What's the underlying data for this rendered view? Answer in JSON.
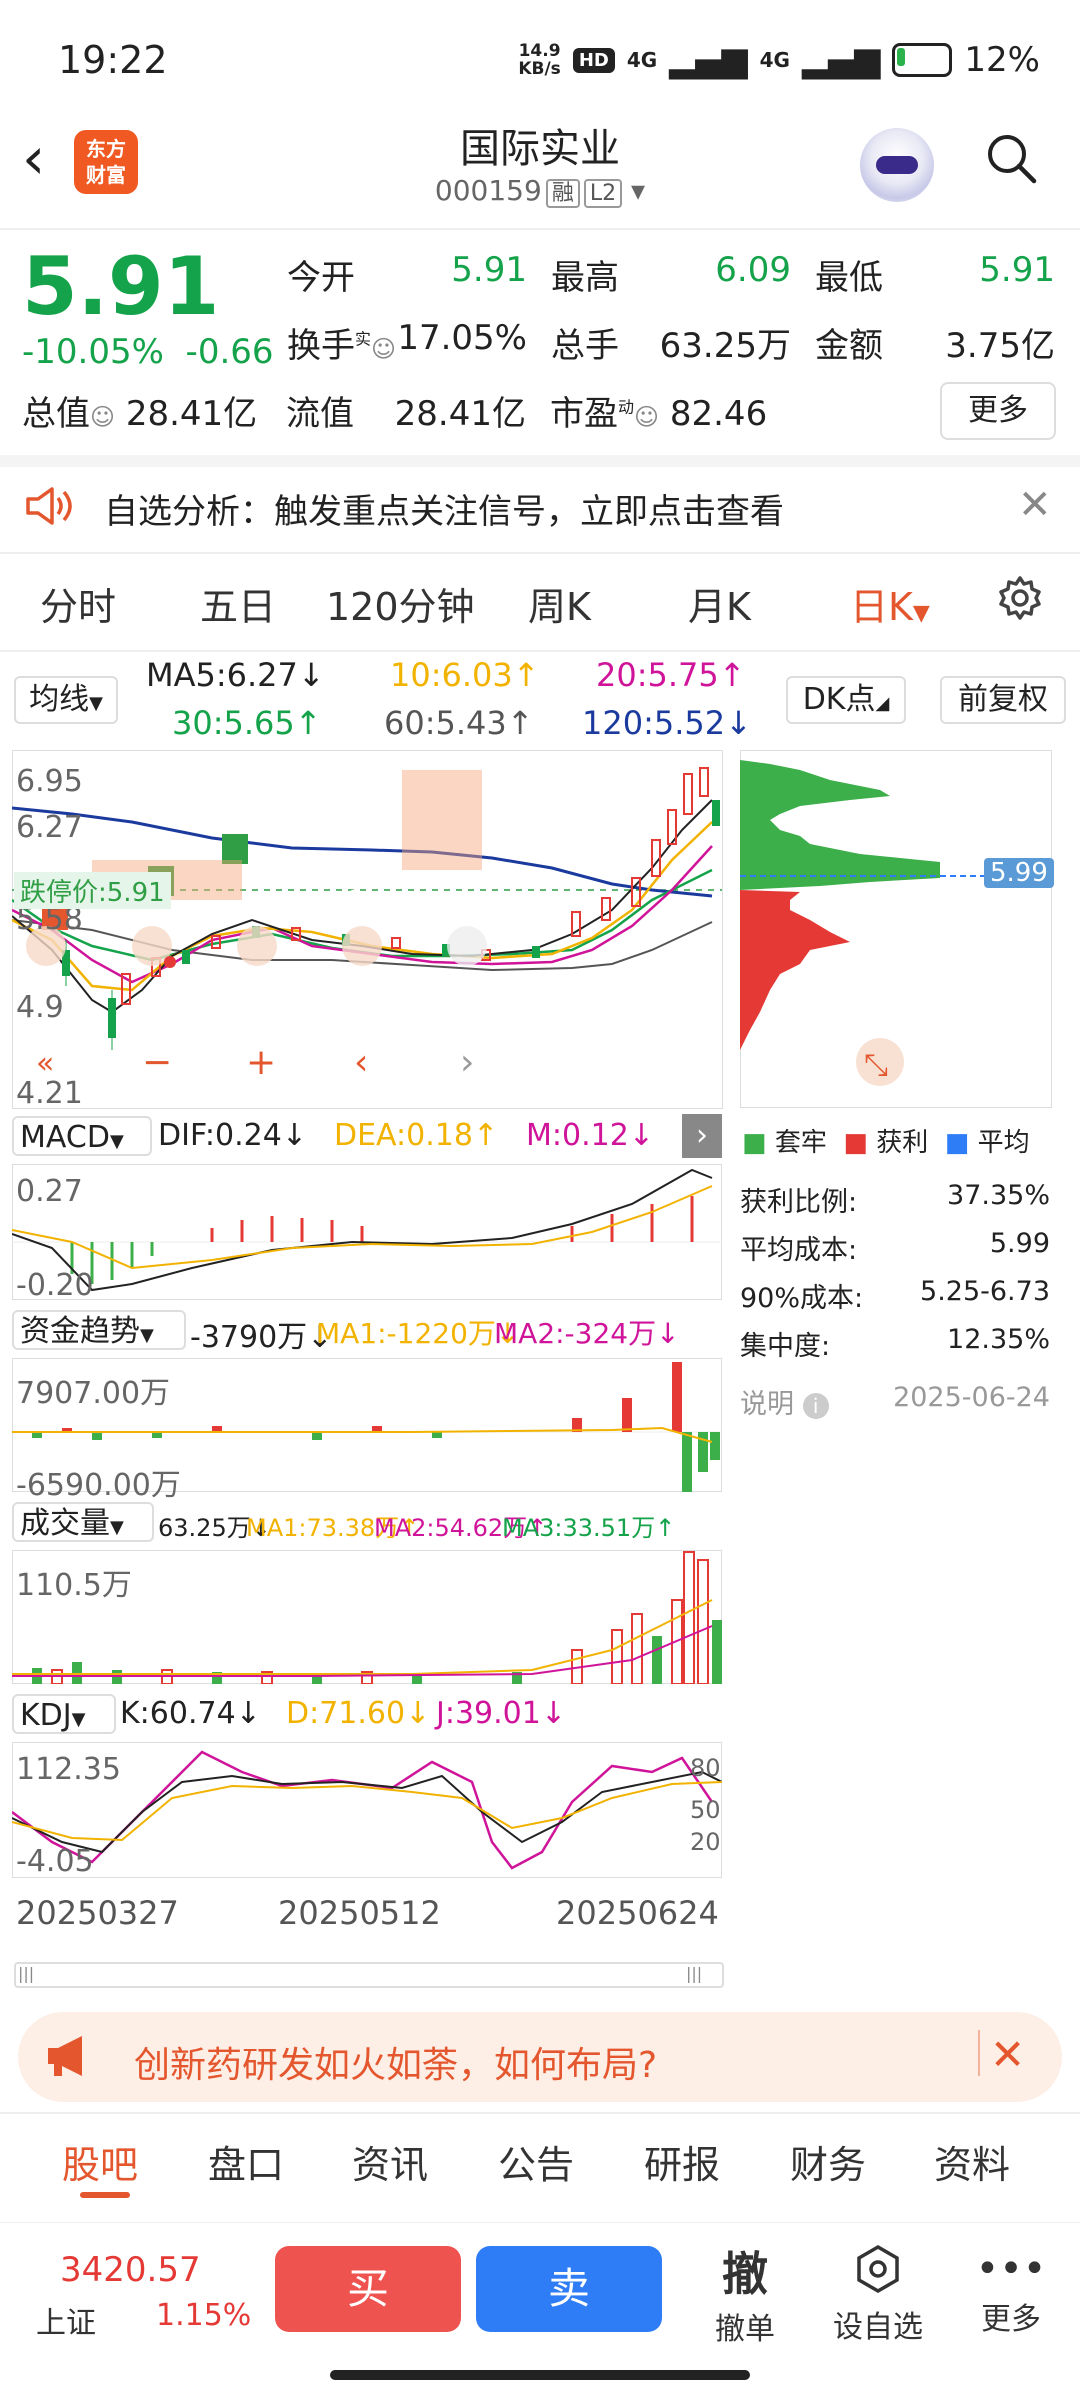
{
  "status_bar": {
    "time": "19:22",
    "net_speed_top": "14.9",
    "net_speed_unit": "KB/s",
    "hd": "HD",
    "sig1": "4G",
    "sig2": "4G",
    "battery": "12%"
  },
  "header": {
    "logo_line1": "东方",
    "logo_line2": "财富",
    "title": "国际实业",
    "code": "000159",
    "tag1": "融",
    "tag2": "L2"
  },
  "quote": {
    "price": "5.91",
    "change_pct": "-10.05%",
    "change": "-0.66",
    "open_label": "今开",
    "open": "5.91",
    "high_label": "最高",
    "high": "6.09",
    "low_label": "最低",
    "low": "5.91",
    "turnover_label": "换手",
    "turnover_sup": "实",
    "turnover": "17.05%",
    "volume_label": "总手",
    "volume": "63.25万",
    "amount_label": "金额",
    "amount": "3.75亿",
    "total_value_label": "总值",
    "total_value": "28.41亿",
    "float_value_label": "流值",
    "float_value": "28.41亿",
    "pe_label": "市盈",
    "pe_sup": "动",
    "pe": "82.46",
    "more": "更多"
  },
  "notice": {
    "text": "自选分析：触发重点关注信号，立即点击查看"
  },
  "tabs": [
    "分时",
    "五日",
    "120分钟",
    "周K",
    "月K",
    "日K"
  ],
  "ma_row": {
    "selector": "均线",
    "ma5": "MA5:6.27↓",
    "ma10": "10:6.03↑",
    "ma20": "20:5.75↑",
    "ma30": "30:5.65↑",
    "ma60": "60:5.43↑",
    "ma120": "120:5.52↓",
    "dk": "DK点",
    "fq": "前复权"
  },
  "main_chart": {
    "y_top": "6.95",
    "y_2": "6.27",
    "y_3": "5.58",
    "y_4": "4.9",
    "y_bottom": "4.21",
    "limit_label": "跌停价:5.91",
    "marker_9": "9",
    "chip_price": "5.99"
  },
  "chip_legend": {
    "a": "套牢",
    "b": "获利",
    "c": "平均"
  },
  "chip_info": [
    {
      "label": "获利比例:",
      "value": "37.35%"
    },
    {
      "label": "平均成本:",
      "value": "5.99"
    },
    {
      "label": "90%成本:",
      "value": "5.25-6.73"
    },
    {
      "label": "集中度:",
      "value": "12.35%"
    },
    {
      "label": "说明",
      "value": "2025-06-24"
    }
  ],
  "macd": {
    "selector": "MACD",
    "dif": "DIF:0.24↓",
    "dea": "DEA:0.18↑",
    "m": "M:0.12↓",
    "y_top": "0.27",
    "y_bottom": "-0.20"
  },
  "fund": {
    "selector": "资金趋势",
    "val": "-3790万↓",
    "ma1": "MA1:-1220万↓",
    "ma2": "MA2:-324万↓",
    "y_top": "7907.00万",
    "y_bottom": "-6590.00万"
  },
  "vol": {
    "selector": "成交量",
    "val": "63.25万↓",
    "ma1": "MA1:73.38万↑",
    "ma2": "MA2:54.62万↑",
    "ma3": "MA3:33.51万↑",
    "y_top": "110.5万"
  },
  "kdj": {
    "selector": "KDJ",
    "k": "K:60.74↓",
    "d": "D:71.60↓",
    "j": "J:39.01↓",
    "y_top": "112.35",
    "y_bottom": "-4.05",
    "r80": "80",
    "r50": "50",
    "r20": "20"
  },
  "dates": [
    "20250327",
    "20250512",
    "20250624"
  ],
  "banner": {
    "text": "创新药研发如火如荼，如何布局?"
  },
  "bottom_tabs": [
    "股吧",
    "盘口",
    "资讯",
    "公告",
    "研报",
    "财务",
    "资料"
  ],
  "action_bar": {
    "index_value": "3420.57",
    "index_name": "上证",
    "index_pct": "1.15%",
    "buy": "买",
    "sell": "卖",
    "cancel_icon": "撤",
    "cancel": "撤单",
    "watch": "设自选",
    "more": "更多"
  }
}
